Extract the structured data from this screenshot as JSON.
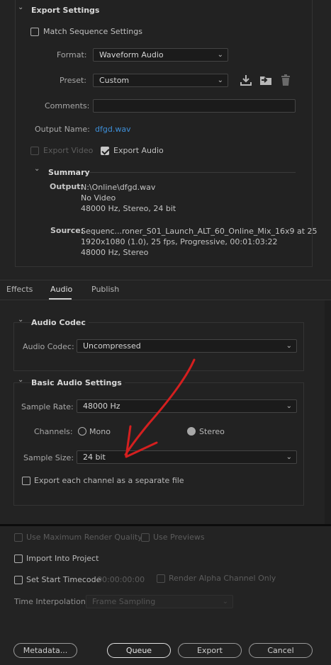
{
  "export_settings": {
    "header": "Export Settings",
    "match_sequence": "Match Sequence Settings",
    "format_label": "Format:",
    "format_value": "Waveform Audio",
    "preset_label": "Preset:",
    "preset_value": "Custom",
    "comments_label": "Comments:",
    "output_name_label": "Output Name:",
    "output_name_value": "dfgd.wav",
    "export_video": "Export Video",
    "export_audio": "Export Audio"
  },
  "summary": {
    "header": "Summary",
    "output_label": "Output:",
    "output_lines": [
      "N:\\Online\\dfgd.wav",
      "No Video",
      "48000 Hz, Stereo, 24 bit"
    ],
    "source_label": "Source:",
    "source_lines": [
      "Sequenc...roner_S01_Launch_ALT_60_Online_Mix_16x9 at 25",
      "1920x1080 (1.0), 25 fps, Progressive, 00:01:03:22",
      "48000 Hz, Stereo"
    ]
  },
  "tabs": [
    "Effects",
    "Audio",
    "Publish"
  ],
  "audio_codec": {
    "header": "Audio Codec",
    "label": "Audio Codec:",
    "value": "Uncompressed"
  },
  "basic_audio": {
    "header": "Basic Audio Settings",
    "sample_rate_label": "Sample Rate:",
    "sample_rate_value": "48000 Hz",
    "channels_label": "Channels:",
    "mono": "Mono",
    "stereo": "Stereo",
    "sample_size_label": "Sample Size:",
    "sample_size_value": "24 bit",
    "separate_file": "Export each channel as a separate file"
  },
  "bottom": {
    "max_render": "Use Maximum Render Quality",
    "use_previews": "Use Previews",
    "import_project": "Import Into Project",
    "set_start_tc": "Set Start Timecode",
    "timecode": "00:00:00:00",
    "render_alpha": "Render Alpha Channel Only",
    "time_interp_label": "Time Interpolation:",
    "time_interp_value": "Frame Sampling"
  },
  "buttons": {
    "metadata": "Metadata...",
    "queue": "Queue",
    "export": "Export",
    "cancel": "Cancel"
  },
  "colors": {
    "annotation_arrow": "#d41f1f",
    "link": "#3e8fd8",
    "background": "#232323"
  }
}
